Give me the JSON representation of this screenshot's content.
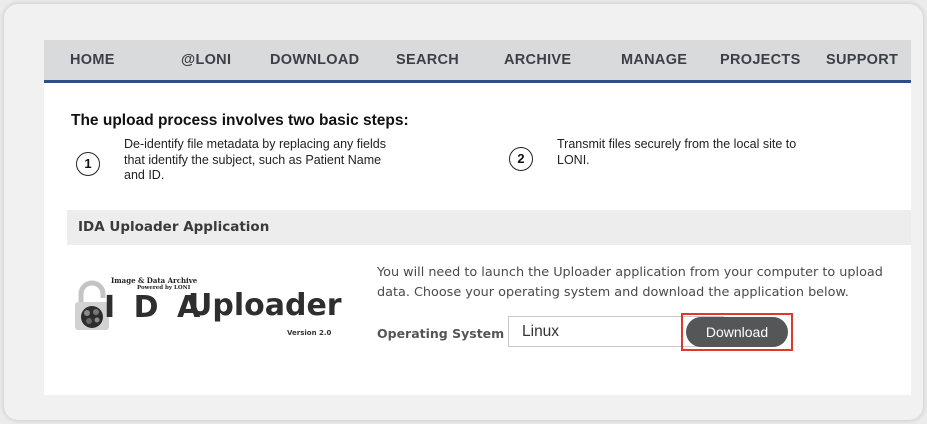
{
  "nav": {
    "items": [
      "HOME",
      "@LONI",
      "DOWNLOAD",
      "SEARCH",
      "ARCHIVE",
      "MANAGE",
      "PROJECTS",
      "SUPPORT"
    ]
  },
  "steps": {
    "heading": "The upload process involves two basic steps:",
    "items": [
      {
        "number": "1",
        "lines": [
          "De-identify file metadata by replacing any fields",
          "that identify the subject, such as Patient Name",
          "and ID."
        ]
      },
      {
        "number": "2",
        "lines": [
          "Transmit files securely from the local site to",
          "LONI."
        ]
      }
    ]
  },
  "uploader": {
    "section_title": "IDA Uploader Application",
    "logo": {
      "line1": "Image & Data Archive",
      "line2": "Powered by LONI",
      "letters": "I D A",
      "word": "Uploader",
      "version": "Version 2.0"
    },
    "description_lines": [
      "You will need to launch the Uploader application from your computer to upload",
      "data. Choose your operating system and download the application below."
    ],
    "os_label": "Operating System",
    "os_value": "Linux",
    "download_label": "Download"
  },
  "colors": {
    "nav_background": "#d9dadc",
    "nav_underline": "#2c4f84",
    "download_button": "#555658",
    "highlight": "#e2382a"
  },
  "icons": [
    "brain-lock-icon",
    "chevron-down-icon"
  ]
}
